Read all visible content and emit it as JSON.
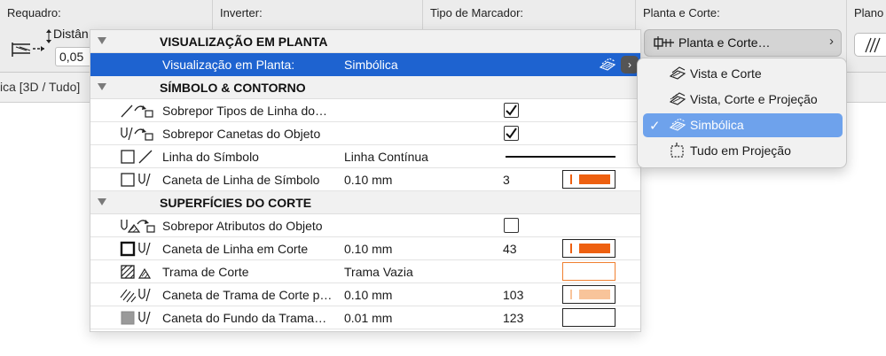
{
  "toolbar": {
    "sections": [
      {
        "label": "Requadro:"
      },
      {
        "label": "Inverter:"
      },
      {
        "label": "Tipo de Marcador:"
      },
      {
        "label": "Planta e Corte:"
      },
      {
        "label": "Plano"
      }
    ],
    "reframe": {
      "distance_label": "Distân",
      "distance_value": "0,05"
    },
    "plan_button": {
      "label": "Planta e Corte…",
      "arrow": "›"
    },
    "subbar_text": "ica [3D / Tudo]"
  },
  "panel": {
    "groups": [
      {
        "title": "VISUALIZAÇÃO EM PLANTA"
      },
      {
        "title": "SÍMBOLO & CONTORNO"
      },
      {
        "title": "SUPERFÍCIES DO CORTE"
      }
    ],
    "rows": [
      {
        "label": "Visualização em Planta:",
        "value": "Simbólica",
        "icon": "floor-plan-display-icon"
      },
      {
        "label": "Sobrepor Tipos de Linha do…",
        "checked": true,
        "icon": "override-line-types-icon"
      },
      {
        "label": "Sobrepor Canetas do Objeto",
        "checked": true,
        "icon": "override-pens-icon"
      },
      {
        "label": "Linha do Símbolo",
        "value": "Linha Contínua",
        "icon": "symbol-line-icon"
      },
      {
        "label": "Caneta de Linha de Símbolo",
        "value": "0.10 mm",
        "pen": "3",
        "icon": "symbol-line-pen-icon"
      },
      {
        "label": "Sobrepor Atributos do Objeto",
        "checked": false,
        "icon": "override-attributes-icon"
      },
      {
        "label": "Caneta de Linha em Corte",
        "value": "0.10 mm",
        "pen": "43",
        "icon": "cut-line-pen-icon"
      },
      {
        "label": "Trama de Corte",
        "value": "Trama Vazia",
        "icon": "cut-fill-icon"
      },
      {
        "label": "Caneta de Trama de Corte p…",
        "value": "0.10 mm",
        "pen": "103",
        "icon": "cut-fill-pen-icon"
      },
      {
        "label": "Caneta do Fundo da Trama…",
        "value": "0.01 mm",
        "pen": "123",
        "icon": "fill-background-pen-icon"
      }
    ]
  },
  "popup": {
    "items": [
      {
        "label": "Vista e Corte",
        "icon": "view-and-section-icon"
      },
      {
        "label": "Vista, Corte e Projeção",
        "icon": "view-section-projection-icon"
      },
      {
        "label": "Simbólica",
        "icon": "symbolic-icon",
        "selected": true,
        "check": "✓"
      },
      {
        "label": "Tudo em Projeção",
        "icon": "all-projected-icon"
      }
    ]
  },
  "colors": {
    "selection": "#1e63d0",
    "popup_highlight": "#6ea2ec",
    "pen_orange": "#ee6010",
    "pen_light_orange": "#f8c49a",
    "empty_fill_border": "#f08030"
  }
}
